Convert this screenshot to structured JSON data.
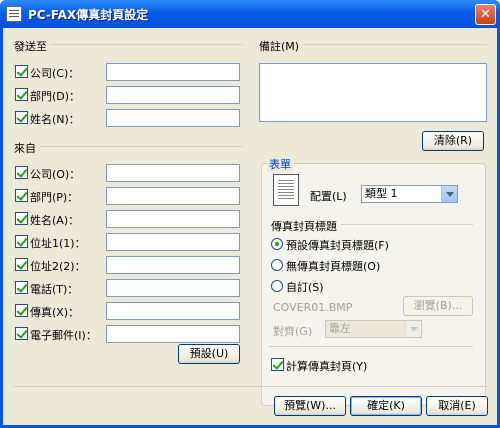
{
  "window": {
    "title": "PC-FAX傳真封頁設定",
    "close_label": "✕"
  },
  "send_to": {
    "group_label": "發送至",
    "fields": [
      {
        "label": "公司(C)：",
        "value": "",
        "checked": true
      },
      {
        "label": "部門(D)：",
        "value": "",
        "checked": true
      },
      {
        "label": "姓名(N)：",
        "value": "",
        "checked": true
      }
    ]
  },
  "from": {
    "group_label": "來自",
    "fields": [
      {
        "label": "公司(O)：",
        "value": "",
        "checked": true
      },
      {
        "label": "部門(P)：",
        "value": "",
        "checked": true
      },
      {
        "label": "姓名(A)：",
        "value": "",
        "checked": true
      },
      {
        "label": "位址1(1)：",
        "value": "",
        "checked": true
      },
      {
        "label": "位址2(2)：",
        "value": "",
        "checked": true
      },
      {
        "label": "電話(T)：",
        "value": "",
        "checked": true
      },
      {
        "label": "傳真(X)：",
        "value": "",
        "checked": true
      },
      {
        "label": "電子郵件(I)：",
        "value": "",
        "checked": true
      }
    ],
    "default_button": "預設(U)"
  },
  "comment": {
    "group_label": "備註(M)",
    "value": "",
    "clear_button": "清除(R)"
  },
  "form": {
    "title": "表單",
    "layout_label": "配置(L)",
    "layout_value": "類型 1",
    "cover_title_group": "傳真封頁標題",
    "radio_default": "預設傳真封頁標題(F)",
    "radio_none": "無傳真封頁標題(O)",
    "radio_custom": "自訂(S)",
    "file_name": "COVER01.BMP",
    "browse_button": "瀏覽(B)...",
    "align_label": "對齊(G)",
    "align_value": "靠左",
    "count_label": "計算傳真封頁(Y)",
    "count_checked": true
  },
  "footer": {
    "preview_button": "預覽(W)...",
    "ok_button": "確定(K)",
    "cancel_button": "取消(E)"
  }
}
